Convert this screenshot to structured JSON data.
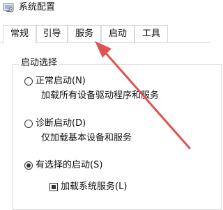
{
  "window": {
    "title": "系统配置",
    "app_icon": "msconfig-icon"
  },
  "tabs": [
    {
      "label": "常规",
      "active": true
    },
    {
      "label": "引导",
      "active": false
    },
    {
      "label": "服务",
      "active": false
    },
    {
      "label": "启动",
      "active": false
    },
    {
      "label": "工具",
      "active": false
    }
  ],
  "startup_selection": {
    "title": "启动选择",
    "options": [
      {
        "label": "正常启动(N)",
        "description": "加载所有设备驱动程序和服务",
        "selected": false
      },
      {
        "label": "诊断启动(D)",
        "description": "仅加载基本设备和服务",
        "selected": false
      },
      {
        "label": "有选择的启动(S)",
        "selected": true
      }
    ],
    "checkbox": {
      "label": "加载系统服务(L)",
      "state": "indeterminate"
    }
  },
  "annotation": {
    "type": "arrow",
    "color": "#e0524f",
    "points_to": "服务"
  }
}
